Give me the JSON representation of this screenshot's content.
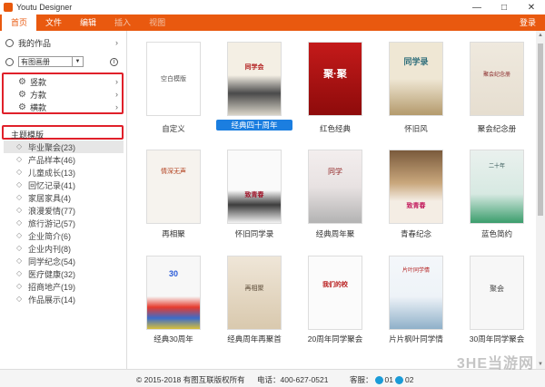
{
  "window": {
    "title": "Youtu Designer",
    "controls": [
      "—",
      "□",
      "✕"
    ]
  },
  "menu": {
    "items": [
      "首页",
      "文件",
      "编辑",
      "插入",
      "视图"
    ],
    "login": "登录"
  },
  "sidebar": {
    "my_works": "我的作品",
    "dropdown_value": "有图画册",
    "formats": [
      "竖款",
      "方款",
      "横款"
    ],
    "section_title": "主题模版",
    "categories": [
      "毕业聚会(23)",
      "产品样本(46)",
      "儿童成长(13)",
      "回忆记录(41)",
      "家居家具(4)",
      "浪漫爱情(77)",
      "旅行游记(57)",
      "企业简介(6)",
      "企业内刊(8)",
      "同学纪念(54)",
      "医疗健康(32)",
      "招商地产(19)",
      "作品展示(14)"
    ]
  },
  "templates": {
    "blank_label": "空白模版",
    "rows": [
      [
        "自定义",
        "经典四十周年",
        "红色经典",
        "怀旧风",
        "聚会纪念册"
      ],
      [
        "再相聚",
        "怀旧同学录",
        "经典周年聚",
        "青春纪念",
        "蓝色简约"
      ],
      [
        "经典30周年",
        "经典周年再聚首",
        "20周年同学聚会",
        "片片枫叶同学情",
        "30周年同学聚会"
      ]
    ],
    "selected": "经典四十周年",
    "cover_texts": {
      "r0c1": "同学会",
      "r0c2": "聚·聚",
      "r0c3": "同学录",
      "r0c4": "聚会纪念册",
      "r1c0": "情深无声",
      "r1c1": "致青春",
      "r1c2": "同学",
      "r1c3": "致青春",
      "r1c4": "二十年",
      "r2c0": "30",
      "r2c1": "再相聚",
      "r2c2": "我们的校",
      "r2c3": "片叶同学情",
      "r2c4": "聚会"
    }
  },
  "footer": {
    "copyright": "© 2015-2018 有图互联版权所有",
    "phone": "电话：400-627-0521",
    "service_label": "客服：",
    "qq1": "01",
    "qq2": "02"
  },
  "watermark": "3HE当游网",
  "colors": {
    "accent": "#e9590f",
    "select": "#1b7ee0",
    "highlight_box": "#e0202a"
  }
}
